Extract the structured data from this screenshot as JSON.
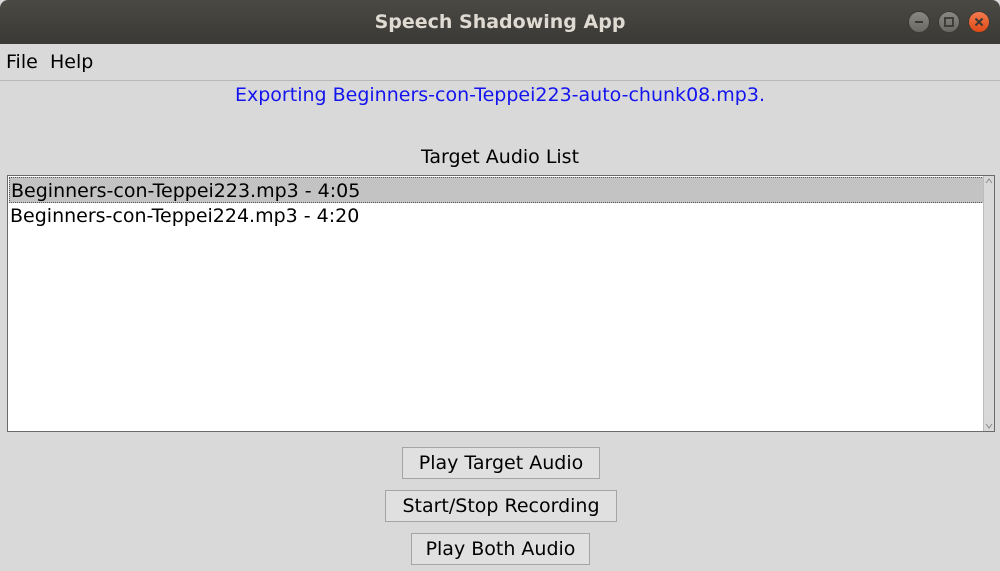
{
  "window": {
    "title": "Speech Shadowing App",
    "controls": {
      "minimize_icon": "minimize-icon",
      "maximize_icon": "maximize-icon",
      "close_icon": "close-icon",
      "close_color": "#e95420"
    }
  },
  "menubar": {
    "items": [
      {
        "label": "File"
      },
      {
        "label": "Help"
      }
    ]
  },
  "status": {
    "text": "Exporting Beginners-con-Teppei223-auto-chunk08.mp3.",
    "color": "#1414ee"
  },
  "audio_list": {
    "label": "Target Audio List",
    "items": [
      {
        "text": "Beginners-con-Teppei223.mp3 - 4:05",
        "selected": true
      },
      {
        "text": "Beginners-con-Teppei224.mp3 - 4:20",
        "selected": false
      }
    ]
  },
  "buttons": {
    "play_target": "Play Target Audio",
    "record": "Start/Stop Recording",
    "play_both": "Play Both Audio"
  }
}
